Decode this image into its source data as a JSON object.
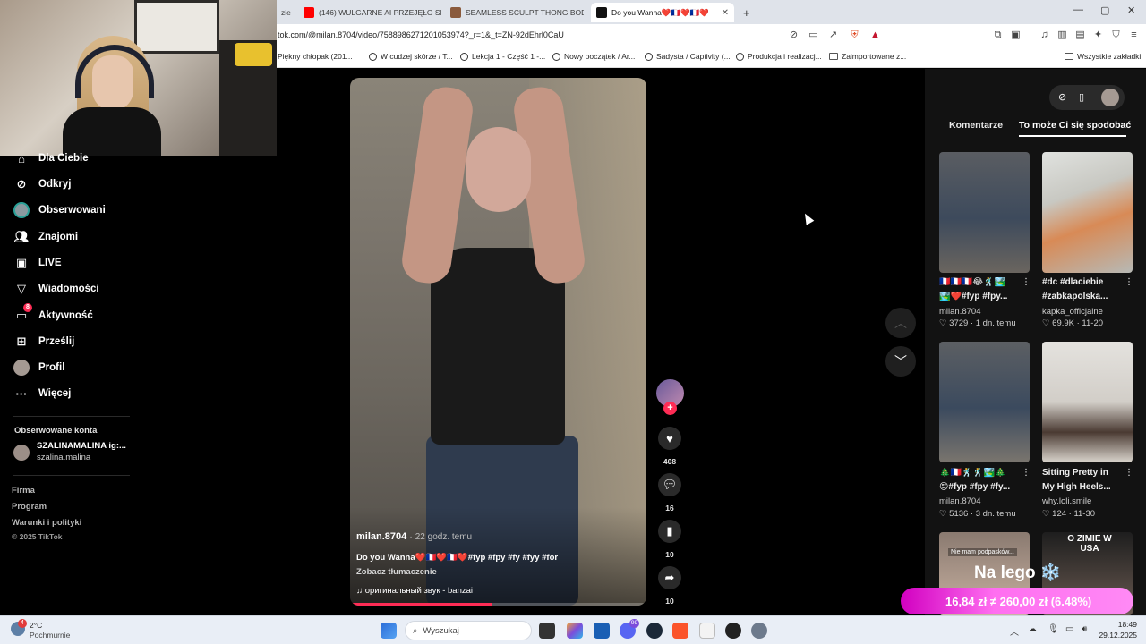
{
  "browser": {
    "tabs": [
      {
        "label": "(146) WULGARNE AI PRZEJĘŁO SPOT",
        "favicon_color": "#ff0000"
      },
      {
        "label": "SEAMLESS SCULPT THONG BODYSU",
        "favicon_color": "#8a5a3c"
      },
      {
        "label": "Do you Wanna❤️🇫🇷❤️🇫🇷❤️",
        "favicon_color": "#111111",
        "active": true
      }
    ],
    "tab_partial_label": "zie",
    "new_tab_label": "+",
    "url": "tok.com/@milan.8704/video/7588986271201053974?_r=1&_t=ZN-92dEhrl0CaU",
    "bookmarks": [
      "Piękny chłopak (201...",
      "W cudzej skórze / T...",
      "Lekcja 1 - Część 1 -...",
      "Nowy początek / Ar...",
      "Sadysta / Captivity (...",
      "Produkcja i realizacj...",
      "Zaimportowane z..."
    ],
    "all_bookmarks": "Wszystkie zakładki",
    "window_controls": [
      "—",
      "▢",
      "✕"
    ]
  },
  "sidebar": {
    "items": [
      {
        "label": "Dla Ciebie",
        "icon": "home-icon"
      },
      {
        "label": "Odkryj",
        "icon": "compass-icon"
      },
      {
        "label": "Obserwowani",
        "icon": "avatar-icon"
      },
      {
        "label": "Znajomi",
        "icon": "friends-icon"
      },
      {
        "label": "LIVE",
        "icon": "live-icon"
      },
      {
        "label": "Wiadomości",
        "icon": "send-icon"
      },
      {
        "label": "Aktywność",
        "icon": "inbox-icon",
        "badge": "8"
      },
      {
        "label": "Prześlij",
        "icon": "upload-icon"
      },
      {
        "label": "Profil",
        "icon": "profile-avatar-icon"
      },
      {
        "label": "Więcej",
        "icon": "more-icon"
      }
    ],
    "followed_header": "Obserwowane konta",
    "followed_account": {
      "name": "SZALINAMALINA ig:...",
      "handle": "szalina.malina"
    },
    "footer": [
      "Firma",
      "Program",
      "Warunki i polityki",
      "© 2025 TikTok"
    ]
  },
  "video": {
    "author": "milan.8704",
    "time_sep": "·",
    "time": "22 godz. temu",
    "caption": "Do you Wanna❤️🇫🇷❤️🇫🇷❤️#fyp #fpy #fy #fyy #for",
    "translate": "Zobacz tłumaczenie",
    "music_note": "♫",
    "sound": "оригинальный звук - banzai",
    "progress": 0.48,
    "actions": [
      {
        "icon": "heart-icon",
        "count": "408"
      },
      {
        "icon": "comment-icon",
        "count": "16"
      },
      {
        "icon": "bookmark-icon",
        "count": "10"
      },
      {
        "icon": "share-icon",
        "count": "10"
      }
    ],
    "follow_plus": "+"
  },
  "right_panel": {
    "tabs": [
      "Komentarze",
      "To może Ci się spodobać"
    ],
    "active_tab": 1,
    "cards": [
      {
        "caption": "🇫🇷🇫🇷🇫🇷😂🕺🏞️",
        "caption2": "🏞️❤️#fyp #fpy...",
        "author": "milan.8704",
        "stats": "3729 · 1 dn. temu",
        "color1": "#3b3f46",
        "color2": "#6e6a66"
      },
      {
        "caption": "#dc #dlaciebie",
        "caption2": "#zabkapolska...",
        "author": "kapka_officjalne",
        "stats": "69.9K · 11-20",
        "color1": "#c7c9c4",
        "color2": "#d68850"
      },
      {
        "caption": "🎄🇫🇷🕺🕺🏞️🎄",
        "caption2": "😍#fyp #fpy #fy...",
        "author": "milan.8704",
        "stats": "5136 · 3 dn. temu",
        "color1": "#3a3d44",
        "color2": "#7b7670"
      },
      {
        "caption": "Sitting Pretty in",
        "caption2": "My High Heels...",
        "author": "why.loli.smile",
        "stats": "124 · 11-30",
        "color1": "#d8d6d2",
        "color2": "#3a2a24"
      },
      {
        "caption": "",
        "caption2": "",
        "author": "",
        "stats": "",
        "color1": "#7a6a60",
        "color2": "#c9b2a2",
        "overlay": "Nie mam podpasków..."
      },
      {
        "caption": "",
        "caption2": "",
        "author": "",
        "stats": "",
        "color1": "#2a2a2a",
        "color2": "#6b5b52",
        "overlay": "O ZIMIE W USA"
      }
    ]
  },
  "overlay_promo": {
    "headline": "Na lego ❄️",
    "price_line": "16,84 zł ≠ 260,00 zł (6.48%)"
  },
  "taskbar": {
    "weather_temp": "2°C",
    "weather_desc": "Pochmurnie",
    "weather_badge": "4",
    "search_placeholder": "Wyszukaj",
    "time": "18:49",
    "date": "29.12.2025",
    "badge_count": "99"
  },
  "colors": {
    "accent": "#fe2c55",
    "panel": "#121212",
    "chrome": "#dfe3ea"
  }
}
